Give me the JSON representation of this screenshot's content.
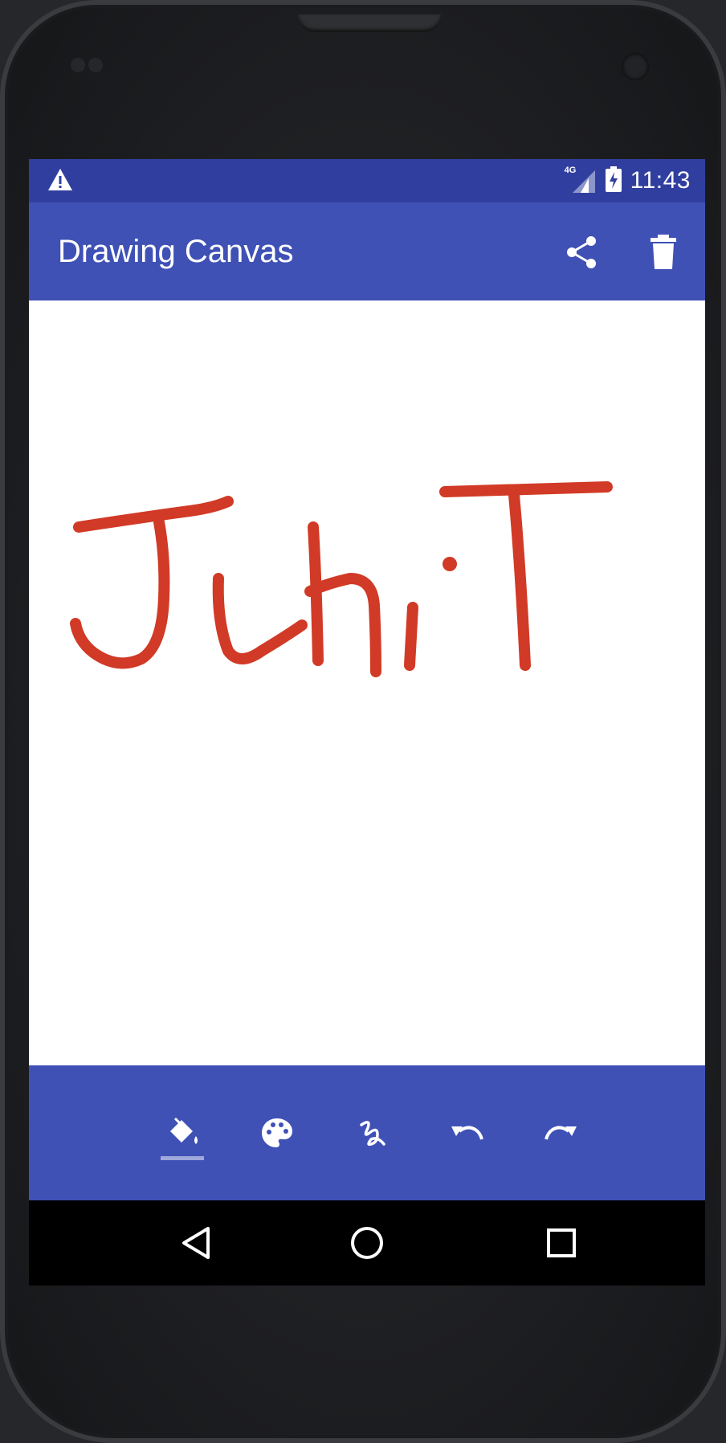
{
  "status_bar": {
    "network": "4G",
    "time": "11:43"
  },
  "app_bar": {
    "title": "Drawing Canvas",
    "actions": [
      {
        "icon": "share-icon"
      },
      {
        "icon": "delete-icon"
      }
    ]
  },
  "canvas": {
    "stroke_color": "#d13a26",
    "drawn_text": "JuhiT"
  },
  "toolbar": {
    "tools": [
      {
        "icon": "fill-bucket-icon",
        "selected": true
      },
      {
        "icon": "palette-icon",
        "selected": false
      },
      {
        "icon": "brush-stroke-icon",
        "selected": false
      },
      {
        "icon": "undo-icon",
        "selected": false
      },
      {
        "icon": "redo-icon",
        "selected": false
      }
    ]
  },
  "nav_bar": {
    "buttons": [
      {
        "icon": "back-triangle-icon"
      },
      {
        "icon": "home-circle-icon"
      },
      {
        "icon": "recents-square-icon"
      }
    ]
  },
  "colors": {
    "primary": "#3f51b5",
    "primary_dark": "#303f9f",
    "accent_underline": "#9fa8da",
    "ink": "#d13a26"
  }
}
